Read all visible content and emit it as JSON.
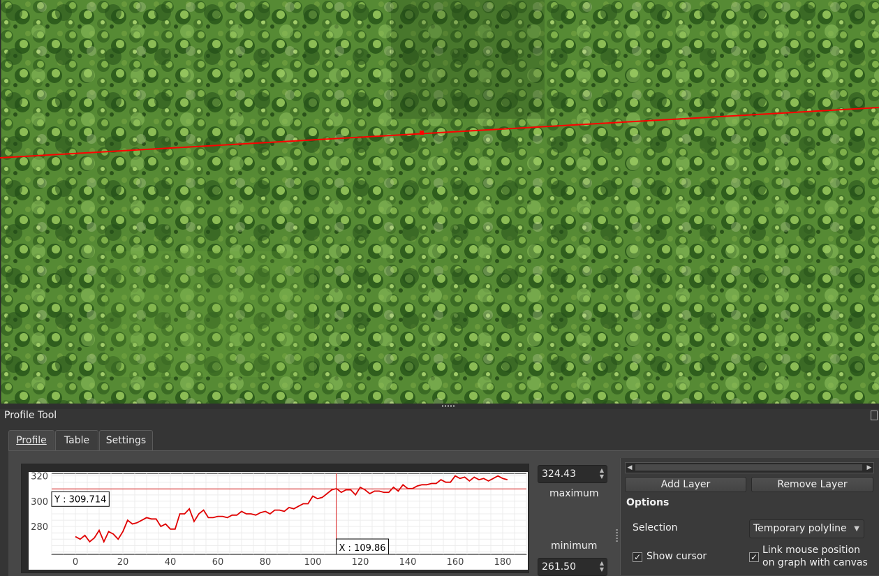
{
  "panel": {
    "title": "Profile Tool"
  },
  "tabs": [
    {
      "label": "Profile",
      "active": true
    },
    {
      "label": "Table",
      "active": false
    },
    {
      "label": "Settings",
      "active": false
    }
  ],
  "range": {
    "maximum_value": "324.43",
    "maximum_label": "maximum",
    "minimum_label": "minimum",
    "minimum_value": "261.50"
  },
  "right": {
    "add_layer": "Add Layer",
    "remove_layer": "Remove Layer",
    "options_heading": "Options",
    "selection_label": "Selection",
    "selection_value": "Temporary polyline",
    "show_cursor": "Show cursor",
    "link_mouse_line1": "Link mouse position",
    "link_mouse_line2": "on graph with canvas"
  },
  "colors": {
    "profile_line": "#e00000",
    "cursor_line": "#e02020",
    "panel_bg": "#353535"
  },
  "icons": {
    "spin_up": "triangle-up",
    "spin_down": "triangle-down",
    "dropdown": "chevron-down",
    "scroll_left": "triangle-left",
    "scroll_right": "triangle-right",
    "check": "check-mark"
  },
  "chart_data": {
    "type": "line",
    "title": "",
    "xlabel": "",
    "ylabel": "",
    "xlim": [
      -10,
      190
    ],
    "ylim": [
      258,
      322
    ],
    "xticks": [
      0,
      20,
      40,
      60,
      80,
      100,
      120,
      140,
      160,
      180
    ],
    "yticks": [
      280,
      300,
      320
    ],
    "grid": true,
    "cursor": {
      "x": 109.86,
      "y": 309.714,
      "x_label": "X : 109.86",
      "y_label": "Y : 309.714"
    },
    "series": [
      {
        "x": [
          0,
          2,
          4,
          6,
          8,
          10,
          12,
          14,
          16,
          18,
          20,
          22,
          24,
          26,
          28,
          30,
          32,
          34,
          36,
          38,
          40,
          42,
          44,
          46,
          48,
          50,
          52,
          54,
          56,
          58,
          60,
          62,
          64,
          66,
          68,
          70,
          72,
          74,
          76,
          78,
          80,
          82,
          84,
          86,
          88,
          90,
          92,
          94,
          96,
          98,
          100,
          102,
          104,
          106,
          108,
          110,
          112,
          114,
          116,
          118,
          120,
          122,
          124,
          126,
          128,
          130,
          132,
          134,
          136,
          138,
          140,
          142,
          144,
          146,
          148,
          150,
          152,
          154,
          156,
          158,
          160,
          162,
          164,
          166,
          168,
          170,
          172,
          174,
          176,
          178,
          180,
          182
        ],
        "y": [
          272,
          270,
          273,
          268,
          271,
          277,
          268,
          276,
          274,
          270,
          276,
          285,
          282,
          283,
          285,
          287,
          286,
          286,
          280,
          282,
          278,
          278,
          290,
          290,
          294,
          284,
          290,
          293,
          287,
          287,
          288,
          288,
          287,
          289,
          289,
          292,
          290,
          290,
          289,
          291,
          292,
          290,
          293,
          293,
          292,
          295,
          294,
          296,
          298,
          298,
          304,
          302,
          303,
          306,
          309,
          310,
          307,
          309,
          309,
          305,
          311,
          309,
          306,
          308,
          308,
          307,
          307,
          311,
          308,
          313,
          310,
          310,
          312,
          313,
          313,
          314,
          314,
          317,
          315,
          315,
          320,
          318,
          319,
          316,
          319,
          317,
          318,
          316,
          318,
          320,
          318,
          317
        ]
      }
    ]
  }
}
